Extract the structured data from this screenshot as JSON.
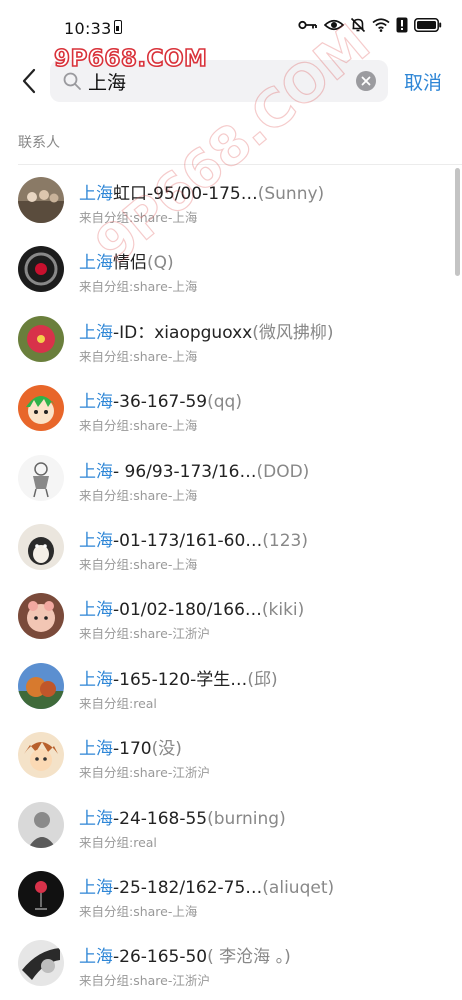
{
  "status_bar": {
    "time": "10:33",
    "icons": [
      "key-icon",
      "eye-icon",
      "mute-bell-icon",
      "wifi-icon",
      "alert-icon",
      "battery-icon"
    ]
  },
  "watermark": {
    "text": "9P668.COM"
  },
  "search": {
    "query": "上海",
    "placeholder": "",
    "cancel_label": "取消"
  },
  "section": {
    "title": "联系人"
  },
  "contacts": [
    {
      "highlight": "上海",
      "name": "虹口-95/00-175…",
      "alias": "(Sunny)",
      "source": "来自分组:share-上海",
      "avatar_color": "#8a7a66"
    },
    {
      "highlight": "上海",
      "name": "情侣",
      "alias": "(Q)",
      "source": "来自分组:share-上海",
      "avatar_color": "#222222"
    },
    {
      "highlight": "上海",
      "name": "-ID：xiaopguoxx",
      "alias": "(微风拂柳)",
      "source": "来自分组:share-上海",
      "avatar_color": "#d8324a"
    },
    {
      "highlight": "上海",
      "name": "-36-167-59",
      "alias": "(qq)",
      "source": "来自分组:share-上海",
      "avatar_color": "#e8662a"
    },
    {
      "highlight": "上海",
      "name": "- 96/93-173/16…",
      "alias": "(DOD)",
      "source": "来自分组:share-上海",
      "avatar_color": "#f3f3f3"
    },
    {
      "highlight": "上海",
      "name": "-01-173/161-60…",
      "alias": "(123)",
      "source": "来自分组:share-上海",
      "avatar_color": "#e9e4dc"
    },
    {
      "highlight": "上海",
      "name": "-01/02-180/166…",
      "alias": "(kiki)",
      "source": "来自分组:share-江浙沪",
      "avatar_color": "#c9a38c"
    },
    {
      "highlight": "上海",
      "name": "-165-120-学生…",
      "alias": "(邱)",
      "source": "来自分组:real",
      "avatar_color": "#d77a2e"
    },
    {
      "highlight": "上海",
      "name": "-170",
      "alias": "(没)",
      "source": "来自分组:share-江浙沪",
      "avatar_color": "#b8602c"
    },
    {
      "highlight": "上海",
      "name": "-24-168-55",
      "alias": "(burning)",
      "source": "来自分组:real",
      "avatar_color": "#d9d9d9"
    },
    {
      "highlight": "上海",
      "name": "-25-182/162-75…",
      "alias": "(aliuqet)",
      "source": "来自分组:share-上海",
      "avatar_color": "#111111"
    },
    {
      "highlight": "上海",
      "name": "-26-165-50",
      "alias": "( 李沧海 。)",
      "source": "来自分组:share-江浙沪",
      "avatar_color": "#e0e0e0"
    }
  ],
  "colors": {
    "accent": "#2e86d6",
    "secondary_text": "#999999",
    "search_bg": "#f2f2f4"
  }
}
